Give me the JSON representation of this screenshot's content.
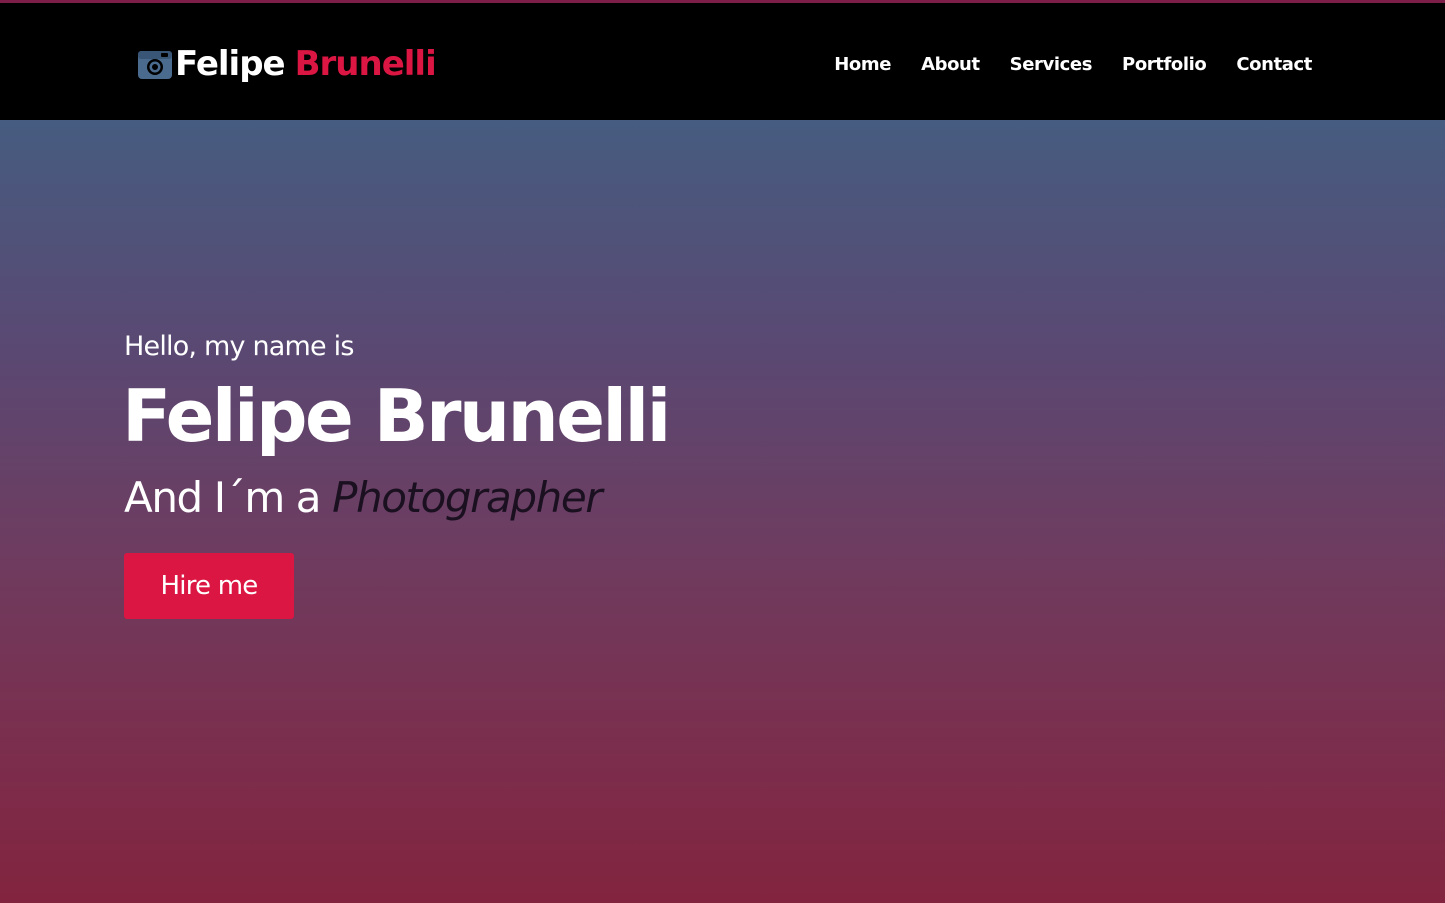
{
  "header": {
    "logo": {
      "first_name": "Felipe",
      "last_name": "Brunelli",
      "icon": "camera-icon"
    },
    "nav": {
      "items": [
        {
          "label": "Home"
        },
        {
          "label": "About"
        },
        {
          "label": "Services"
        },
        {
          "label": "Portfolio"
        },
        {
          "label": "Contact"
        }
      ]
    }
  },
  "hero": {
    "greeting": "Hello, my name is",
    "name": "Felipe Brunelli",
    "tagline_prefix": "And I´m a ",
    "profession": "Photographer",
    "cta_label": "Hire me"
  },
  "colors": {
    "accent": "#dc1643",
    "header_bg": "#000000",
    "gradient_top": "#465c80",
    "gradient_bottom": "#82243f",
    "profession_text": "#1a1020"
  }
}
